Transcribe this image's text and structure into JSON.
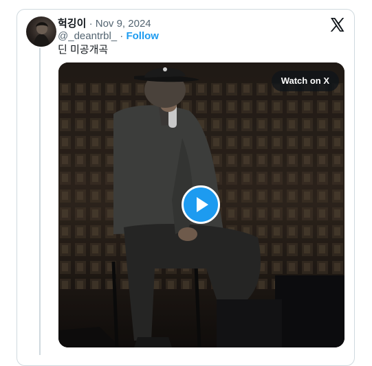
{
  "tweet": {
    "display_name": "헉깅이",
    "separator": " · ",
    "date": "Nov 9, 2024",
    "handle": "@_deantrbl_",
    "follow_separator": " · ",
    "follow_label": "Follow",
    "text": "딘 미공개곡"
  },
  "media": {
    "watch_label": "Watch on X",
    "play_icon": "play-icon"
  },
  "brand": {
    "logo": "x-logo-icon",
    "follow_color": "#1d9bf0",
    "play_button_color": "#1d9bf0"
  }
}
